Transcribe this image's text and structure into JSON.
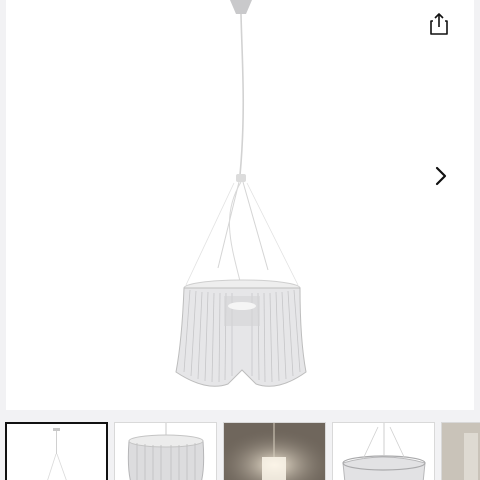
{
  "viewer": {
    "share_icon": "share-icon",
    "next_icon": "chevron-right-icon",
    "image_subject": "pendant-lamp"
  },
  "thumbnails": {
    "selected_index": 0,
    "items": [
      {
        "id": "thumb-1",
        "icon": "lamp-photo"
      },
      {
        "id": "thumb-2",
        "icon": "lamp-photo"
      },
      {
        "id": "thumb-3",
        "icon": "lamp-photo"
      },
      {
        "id": "thumb-4",
        "icon": "lamp-photo"
      },
      {
        "id": "thumb-5",
        "icon": "lamp-photo"
      }
    ]
  },
  "colors": {
    "background": "#f2f2f4",
    "viewer_bg": "#ffffff",
    "selected_border": "#111111",
    "icon": "#111111"
  }
}
